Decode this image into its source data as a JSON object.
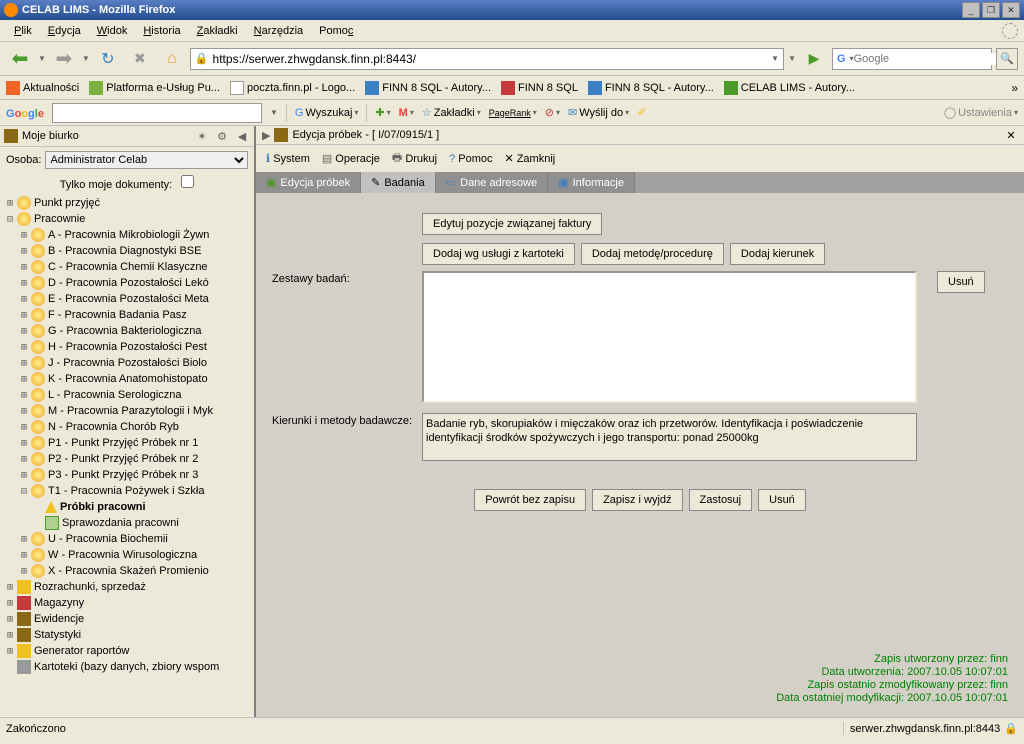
{
  "window": {
    "title": "CELAB LIMS - Mozilla Firefox"
  },
  "menu": {
    "plik": "Plik",
    "edycja": "Edycja",
    "widok": "Widok",
    "historia": "Historia",
    "zakladki": "Zakładki",
    "narzedzia": "Narzędzia",
    "pomoc": "Pomoc"
  },
  "nav": {
    "url": "https://serwer.zhwgdansk.finn.pl:8443/",
    "search_placeholder": "Google"
  },
  "bookmarks": {
    "b1": "Aktualności",
    "b2": "Platforma e-Usług Pu...",
    "b3": "poczta.finn.pl - Logo...",
    "b4": "FINN 8 SQL - Autory...",
    "b5": "FINN 8 SQL",
    "b6": "FINN 8 SQL - Autory...",
    "b7": "CELAB LIMS - Autory..."
  },
  "googlebar": {
    "wyszukaj": "Wyszukaj",
    "zakladki": "Zakładki",
    "pagerank": "PageRank",
    "wyslij": "Wyślij do",
    "ustawienia": "Ustawienia"
  },
  "sidebar": {
    "title": "Moje biurko",
    "osoba_label": "Osoba:",
    "osoba_value": "Administrator Celab",
    "tylko": "Tylko moje dokumenty:",
    "nodes": {
      "punkt": "Punkt przyjęć",
      "pracownie": "Pracownie",
      "A": "A - Pracownia Mikrobiologii Żywn",
      "B": "B - Pracownia Diagnostyki BSE",
      "C": "C - Pracownia Chemii Klasyczne",
      "D": "D - Pracownia Pozostałości Lekó",
      "E": "E - Pracownia Pozostałości Meta",
      "F": "F - Pracownia Badania Pasz",
      "G": "G - Pracownia Bakteriologiczna",
      "H": "H - Pracownia Pozostałości Pest",
      "J": "J - Pracownia Pozostałości Biolo",
      "K": "K - Pracownia Anatomohistopato",
      "L": "L - Pracownia Serologiczna",
      "M": "M - Pracownia Parazytologii i Myk",
      "N": "N - Pracownia Chorób Ryb",
      "P1": "P1 - Punkt Przyjęć Próbek nr 1",
      "P2": "P2 - Punkt Przyjęć Próbek nr 2",
      "P3": "P3 - Punkt Przyjęć Próbek nr 3",
      "T1": "T1 - Pracownia Pożywek i Szkła",
      "probki": "Próbki pracowni",
      "sprawozdania": "Sprawozdania pracowni",
      "U": "U - Pracownia Biochemii",
      "W": "W - Pracownia Wirusologiczna",
      "X": "X - Pracownia Skażeń Promienio",
      "rozrachunki": "Rozrachunki, sprzedaż",
      "magazyny": "Magazyny",
      "ewidencje": "Ewidencje",
      "statystyki": "Statystyki",
      "generator": "Generator raportów",
      "kartoteki": "Kartoteki (bazy danych, zbiory wspom"
    }
  },
  "content": {
    "title": "Edycja próbek - [ I/07/0915/1 ]",
    "toolbar": {
      "system": "System",
      "operacje": "Operacje",
      "drukuj": "Drukuj",
      "pomoc": "Pomoc",
      "zamknij": "Zamknij"
    },
    "tabs": {
      "edycja": "Edycja próbek",
      "badania": "Badania",
      "dane": "Dane adresowe",
      "info": "Informacje"
    },
    "buttons": {
      "edytuj_faktury": "Edytuj pozycje związanej faktury",
      "dodaj_uslugi": "Dodaj wg usługi z kartoteki",
      "dodaj_metode": "Dodaj metodę/procedurę",
      "dodaj_kierunek": "Dodaj kierunek",
      "usun": "Usuń",
      "powrot": "Powrót bez zapisu",
      "zapisz": "Zapisz i wyjdź",
      "zastosuj": "Zastosuj",
      "usun2": "Usuń"
    },
    "labels": {
      "zestawy": "Zestawy badań:",
      "kierunki": "Kierunki i metody badawcze:"
    },
    "kierunki_text": "Badanie ryb, skorupiaków i mięczaków oraz ich przetworów. Identyfikacja i poświadczenie identyfikacji środków spożywczych i jego transportu: ponad 25000kg",
    "audit": {
      "l1": "Zapis utworzony przez: finn",
      "l2": "Data utworzenia: 2007.10.05 10:07:01",
      "l3": "Zapis ostatnio zmodyfikowany przez: finn",
      "l4": "Data ostatniej modyfikacji: 2007.10.05 10:07:01"
    }
  },
  "status": {
    "left": "Zakończono",
    "right": "serwer.zhwgdansk.finn.pl:8443"
  }
}
